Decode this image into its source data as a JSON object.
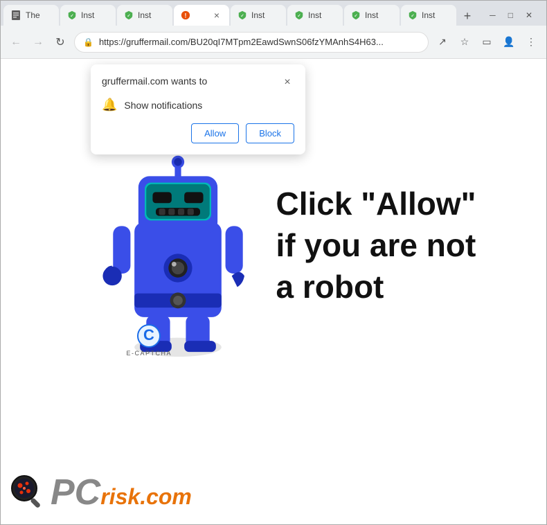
{
  "browser": {
    "tabs": [
      {
        "label": "The",
        "favicon": "doc",
        "active": false
      },
      {
        "label": "Inst",
        "favicon": "shield-green",
        "active": false
      },
      {
        "label": "Inst",
        "favicon": "shield-green",
        "active": false
      },
      {
        "label": "",
        "favicon": "orange-circle",
        "active": true
      },
      {
        "label": "Inst",
        "favicon": "shield-green",
        "active": false
      },
      {
        "label": "Inst",
        "favicon": "shield-green",
        "active": false
      },
      {
        "label": "Inst",
        "favicon": "shield-green",
        "active": false
      },
      {
        "label": "Inst",
        "favicon": "shield-green",
        "active": false
      }
    ],
    "new_tab_label": "+",
    "url": "https://gruffermail.com/BU20qI7MTpm2EawdSwnS06fzYMAnhS4H63...",
    "nav": {
      "back": "←",
      "forward": "→",
      "refresh": "↻"
    },
    "window_controls": {
      "minimize": "─",
      "maximize": "□",
      "close": "✕"
    }
  },
  "popup": {
    "title": "gruffermail.com wants to",
    "close_label": "×",
    "row_text": "Show notifications",
    "allow_label": "Allow",
    "block_label": "Block"
  },
  "page": {
    "captcha_line1": "Click \"Allow\"",
    "captcha_line2": "if you are not",
    "captcha_line3": "a robot",
    "ecaptcha_label": "E-CAPTCHA",
    "pcrisk_pc": "PC",
    "pcrisk_risk": "risk",
    "pcrisk_com": ".com"
  },
  "colors": {
    "robot_body": "#3a4ee8",
    "robot_dark": "#1a2db5",
    "robot_visor": "#00c8c8",
    "robot_visor_dark": "#006666",
    "ecaptcha_c": "#1a6ce8",
    "pcrisk_gray": "#888",
    "pcrisk_orange": "#e8730a"
  }
}
